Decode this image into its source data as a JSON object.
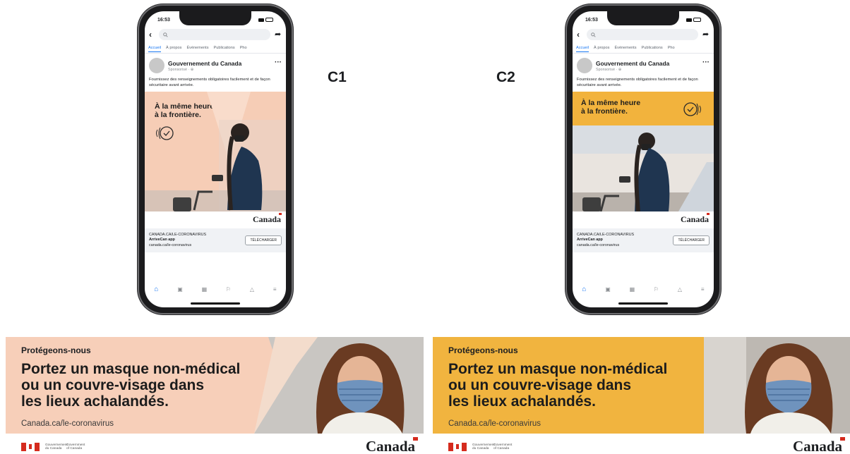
{
  "phones": [
    {
      "status_time": "16:53",
      "tabs": [
        "Accueil",
        "À propos",
        "Événements",
        "Publications",
        "Pho"
      ],
      "page_name": "Gouvernement du Canada",
      "sponsored": "Sponsorisé · ⊕",
      "post_text": "Fournissez des renseignements obligatoires facilement et de façon sécuritaire avant arrivée.",
      "ad_headline_1": "À la même heure",
      "ad_headline_2": "à la frontière.",
      "canada_wordmark": "Canada",
      "link_domain": "CANADA.CA/LE-CORONAVIRUS",
      "link_title": "ArriveCan app",
      "link_url": "canada.ca/le-coronavirus",
      "cta": "TÉLÉCHARGER",
      "variant_color": "#f6cdb6"
    },
    {
      "status_time": "16:53",
      "tabs": [
        "Accueil",
        "À propos",
        "Événements",
        "Publications",
        "Pho"
      ],
      "page_name": "Gouvernement du Canada",
      "sponsored": "Sponsorisé · ⊕",
      "post_text": "Fournissez des renseignements obligatoires facilement et de façon sécuritaire avant arrivée.",
      "ad_headline_1": "À la même heure",
      "ad_headline_2": "à la frontière.",
      "canada_wordmark": "Canada",
      "link_domain": "CANADA.CA/LE-CORONAVIRUS",
      "link_title": "ArriveCan app",
      "link_url": "canada.ca/le-coronavirus",
      "cta": "TÉLÉCHARGER",
      "variant_color": "#f2b33d"
    }
  ],
  "labels": {
    "c1": "C1",
    "c2": "C2"
  },
  "banners": [
    {
      "kicker": "Protégeons-nous",
      "headline_1": "Portez un masque non-médical",
      "headline_2": "ou un couvre-visage dans",
      "headline_3": "les lieux achalandés.",
      "url": "Canada.ca/le-coronavirus",
      "govt_fr": "Gouvernement du Canada",
      "govt_en": "Government of Canada",
      "wordmark": "Canada",
      "bg_color": "#f7cfb9"
    },
    {
      "kicker": "Protégeons-nous",
      "headline_1": "Portez un masque non-médical",
      "headline_2": "ou un couvre-visage dans",
      "headline_3": "les lieux achalandés.",
      "url": "Canada.ca/le-coronavirus",
      "govt_fr": "Gouvernement du Canada",
      "govt_en": "Government of Canada",
      "wordmark": "Canada",
      "bg_color": "#f1b43f"
    }
  ],
  "icons": {
    "back": "back-icon",
    "share": "share-icon",
    "more": "more-icon",
    "nav": [
      "home-icon",
      "video-icon",
      "marketplace-icon",
      "flag-icon",
      "bell-icon",
      "menu-icon"
    ]
  }
}
